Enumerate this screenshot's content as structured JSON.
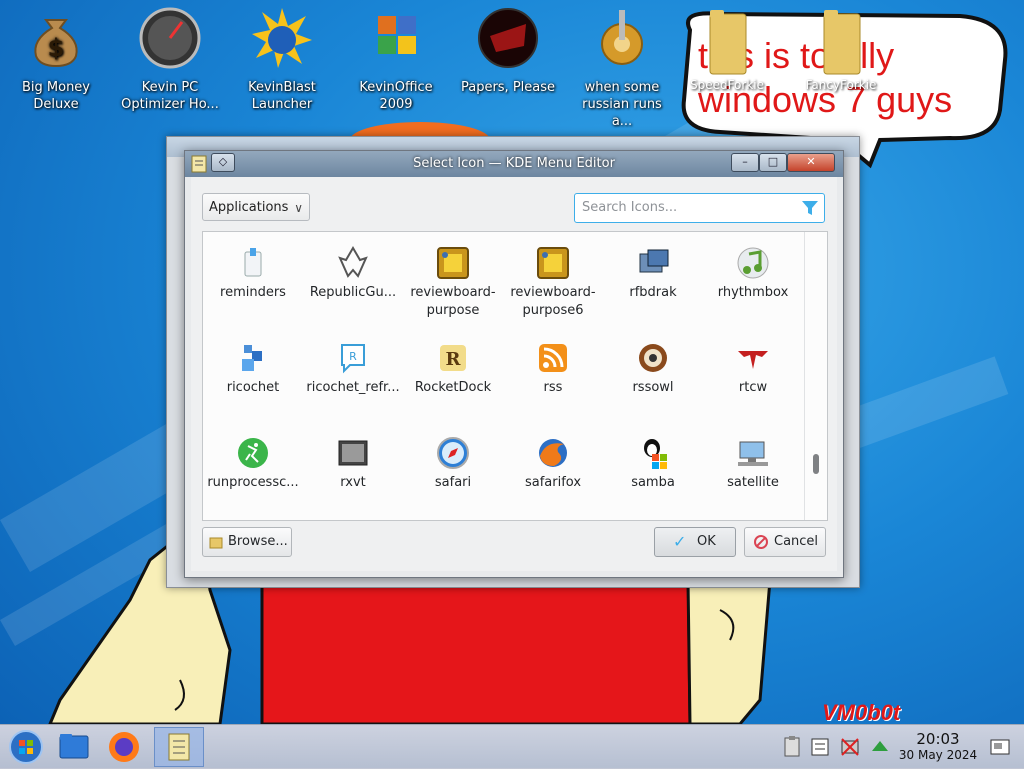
{
  "desktop": {
    "icons": [
      {
        "label": "Big Money Deluxe",
        "icon": "money-bag-icon"
      },
      {
        "label": "Kevin PC Optimizer Ho...",
        "icon": "gauge-icon"
      },
      {
        "label": "KevinBlast Launcher",
        "icon": "burst-globe-icon"
      },
      {
        "label": "KevinOffice 2009",
        "icon": "office-squares-icon"
      },
      {
        "label": "Papers, Please",
        "icon": "papers-please-icon"
      },
      {
        "label": "when some russian runs a...",
        "icon": "gear-icon"
      }
    ],
    "folders": [
      {
        "label": "SpeedForkie",
        "icon": "folder-icon"
      },
      {
        "label": "FancyForkie",
        "icon": "folder-icon"
      }
    ],
    "meme_text_line1": "this is totally",
    "meme_text_line2": "windows 7 guys",
    "signature": "VM0b0t"
  },
  "background_window": {
    "title": "KDE Menu Editor"
  },
  "dialog": {
    "title": "Select Icon — KDE Menu Editor",
    "source_select": {
      "value": "Applications"
    },
    "search": {
      "placeholder": "Search Icons..."
    },
    "icons": [
      {
        "label": "reminders",
        "icon": "reminders-icon"
      },
      {
        "label": "RepublicGu...",
        "icon": "republic-icon"
      },
      {
        "label": "reviewboard-purpose",
        "icon": "reviewboard-icon"
      },
      {
        "label": "reviewboard-purpose6",
        "icon": "reviewboard-icon"
      },
      {
        "label": "rfbdrak",
        "icon": "rfbdrak-icon"
      },
      {
        "label": "rhythmbox",
        "icon": "rhythmbox-icon"
      },
      {
        "label": "ricochet",
        "icon": "ricochet-icon"
      },
      {
        "label": "ricochet_refr...",
        "icon": "ricochet-refresh-icon"
      },
      {
        "label": "RocketDock",
        "icon": "rocketdock-icon"
      },
      {
        "label": "rss",
        "icon": "rss-icon"
      },
      {
        "label": "rssowl",
        "icon": "rssowl-icon"
      },
      {
        "label": "rtcw",
        "icon": "rtcw-icon"
      },
      {
        "label": "runprocessc...",
        "icon": "runprocess-icon"
      },
      {
        "label": "rxvt",
        "icon": "rxvt-icon"
      },
      {
        "label": "safari",
        "icon": "safari-icon"
      },
      {
        "label": "safarifox",
        "icon": "safarifox-icon"
      },
      {
        "label": "samba",
        "icon": "samba-icon"
      },
      {
        "label": "satellite",
        "icon": "satellite-icon"
      }
    ],
    "browse_label": "Browse...",
    "ok_label": "OK",
    "cancel_label": "Cancel"
  },
  "taskbar": {
    "items": [
      "start-orb-icon",
      "file-manager-icon",
      "firefox-icon",
      "kde-menu-editor-icon"
    ],
    "clock": {
      "time": "20:03",
      "date": "30 May 2024"
    }
  },
  "colors": {
    "desktop_blue": "#1a86d6",
    "focus_blue": "#3daee9",
    "meme_red": "#e01818"
  }
}
